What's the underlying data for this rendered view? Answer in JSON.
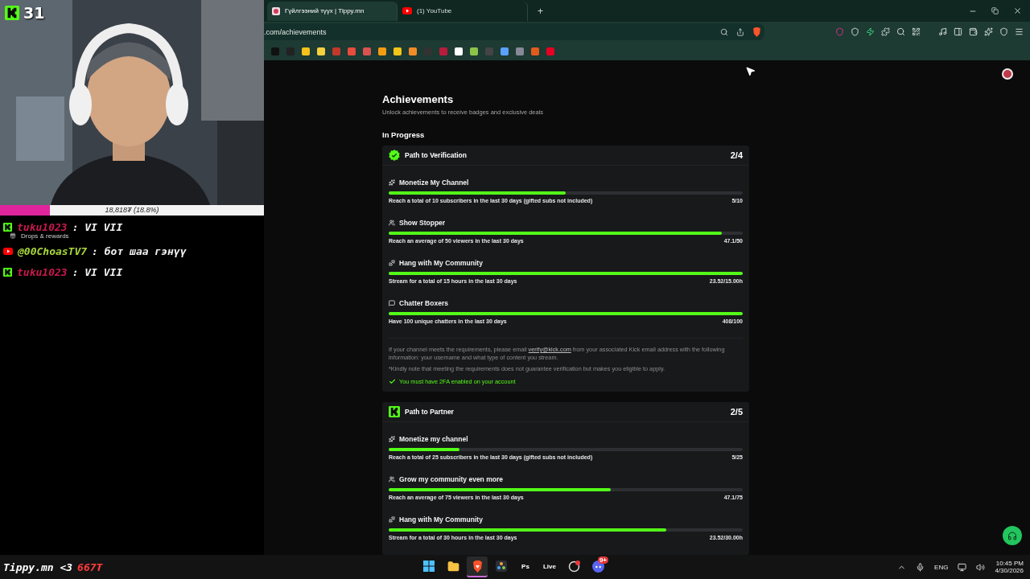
{
  "webcam": {
    "viewer_count": "31"
  },
  "donation_goal": {
    "text": "18,818₮ (18.8%)",
    "level": 0.188
  },
  "chat": [
    {
      "kind": "kick",
      "user": "tuku1023",
      "color": "#c8194c",
      "message": ": VI VII"
    },
    {
      "kind": "notice",
      "text": "Drops & rewards"
    },
    {
      "kind": "youtube",
      "user": "@00ChoasTV7",
      "color": "#a8d63a",
      "message": ": бот шаа гэнүү"
    },
    {
      "kind": "kick",
      "user": "tuku1023",
      "color": "#c8194c",
      "message": ": VI VII"
    }
  ],
  "browser": {
    "tabs": [
      {
        "title": "Гүйлгээний түүх | Tippy.mn",
        "kind": "tippy",
        "selected": true
      },
      {
        "title": "(1) YouTube",
        "kind": "youtube",
        "selected": false
      }
    ],
    "new_tab": "+",
    "address": ".com/achievements"
  },
  "page": {
    "title": "Achievements",
    "subtitle": "Unlock achievements to receive badges and exclusive deals",
    "section": "In Progress",
    "paths": [
      {
        "kind": "verified",
        "title": "Path to Verification",
        "count": "2/4",
        "tasks": [
          {
            "kind": "sparkle",
            "name": "Monetize My Channel",
            "level": 0.5,
            "description": "Reach a total of 10 subscribers in the last 30 days (gifted subs not included)",
            "progress": "5/10"
          },
          {
            "kind": "people",
            "name": "Show Stopper",
            "level": 0.942,
            "description": "Reach an average of 50 viewers in the last 30 days",
            "progress": "47.1/50"
          },
          {
            "kind": "dumbbell",
            "name": "Hang with My Community",
            "level": 1,
            "description": "Stream for a total of 15 hours in the last 30 days",
            "progress": "23.52/15.00h"
          },
          {
            "kind": "chat",
            "name": "Chatter Boxers",
            "level": 1,
            "description": "Have 100 unique chatters in the last 30 days",
            "progress": "408/100"
          }
        ],
        "note": {
          "before": "If your channel meets the requirements, please email ",
          "link": "verify@kick.com",
          "after": " from your associated Kick email address with the following information: your username and what type of content you stream.",
          "disclaimer": "*Kindly note that meeting the requirements does not guarantee verification but makes you eligible to apply.",
          "requirement": "You must have 2FA enabled on your account",
          "met": true
        }
      },
      {
        "kind": "kick",
        "title": "Path to Partner",
        "count": "2/5",
        "tasks": [
          {
            "kind": "sparkle",
            "name": "Monetize my channel",
            "level": 0.2,
            "description": "Reach a total of 25 subscribers in the last 30 days (gifted subs not included)",
            "progress": "5/25"
          },
          {
            "kind": "people",
            "name": "Grow my community even more",
            "level": 0.628,
            "description": "Reach an average of 75 viewers in the last 30 days",
            "progress": "47.1/75"
          },
          {
            "kind": "dumbbell",
            "name": "Hang with My Community",
            "level": 0.784,
            "description": "Stream for a total of 30 hours in the last 30 days",
            "progress": "23.52/30.00h"
          }
        ]
      }
    ]
  },
  "taskbar": {
    "overlay_name": "Tippy.mn <3",
    "overlay_amount": "667₮",
    "apps": [
      {
        "kind": "windows",
        "selected": false
      },
      {
        "kind": "folder",
        "selected": false
      },
      {
        "kind": "browser",
        "selected": true
      },
      {
        "kind": "resolve",
        "selected": false
      },
      {
        "kind": "label",
        "label": "Ps",
        "selected": false
      },
      {
        "kind": "label",
        "label": "Live",
        "selected": false
      },
      {
        "kind": "obs",
        "selected": false
      },
      {
        "kind": "discord",
        "badge": "9+",
        "selected": false
      }
    ],
    "language": "ENG",
    "time": "10:45 PM",
    "date": "4/30/2026"
  }
}
